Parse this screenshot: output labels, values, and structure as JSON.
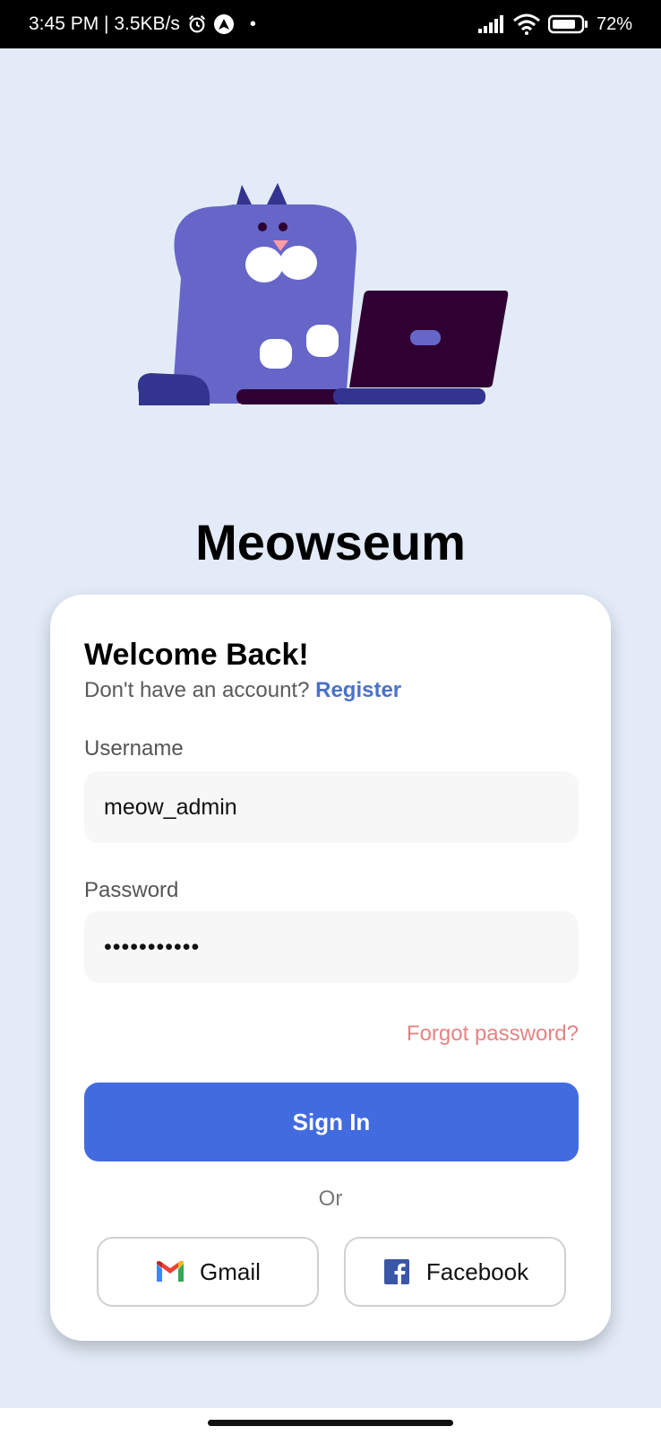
{
  "status_bar": {
    "time_speed": "3:45 PM | 3.5KB/s",
    "dot": "•",
    "battery": "72%",
    "icons": [
      "alarm-icon",
      "navigation-icon",
      "signal-icon",
      "wifi-icon",
      "battery-icon"
    ]
  },
  "app": {
    "title": "Meowseum"
  },
  "login": {
    "heading": "Welcome Back!",
    "no_account_text": "Don't have an account?",
    "register_label": "Register",
    "username_label": "Username",
    "username_value": "meow_admin",
    "password_label": "Password",
    "password_value": "•••••••••••",
    "forgot_label": "Forgot password?",
    "sign_in_label": "Sign In",
    "or_label": "Or",
    "gmail_label": "Gmail",
    "facebook_label": "Facebook"
  },
  "colors": {
    "background": "#e2ebf7",
    "accent": "#436be0",
    "link": "#4a72c8",
    "forgot": "#e38483",
    "cat": "#6566c8",
    "cat_dark": "#33348f",
    "laptop": "#2f0032"
  }
}
